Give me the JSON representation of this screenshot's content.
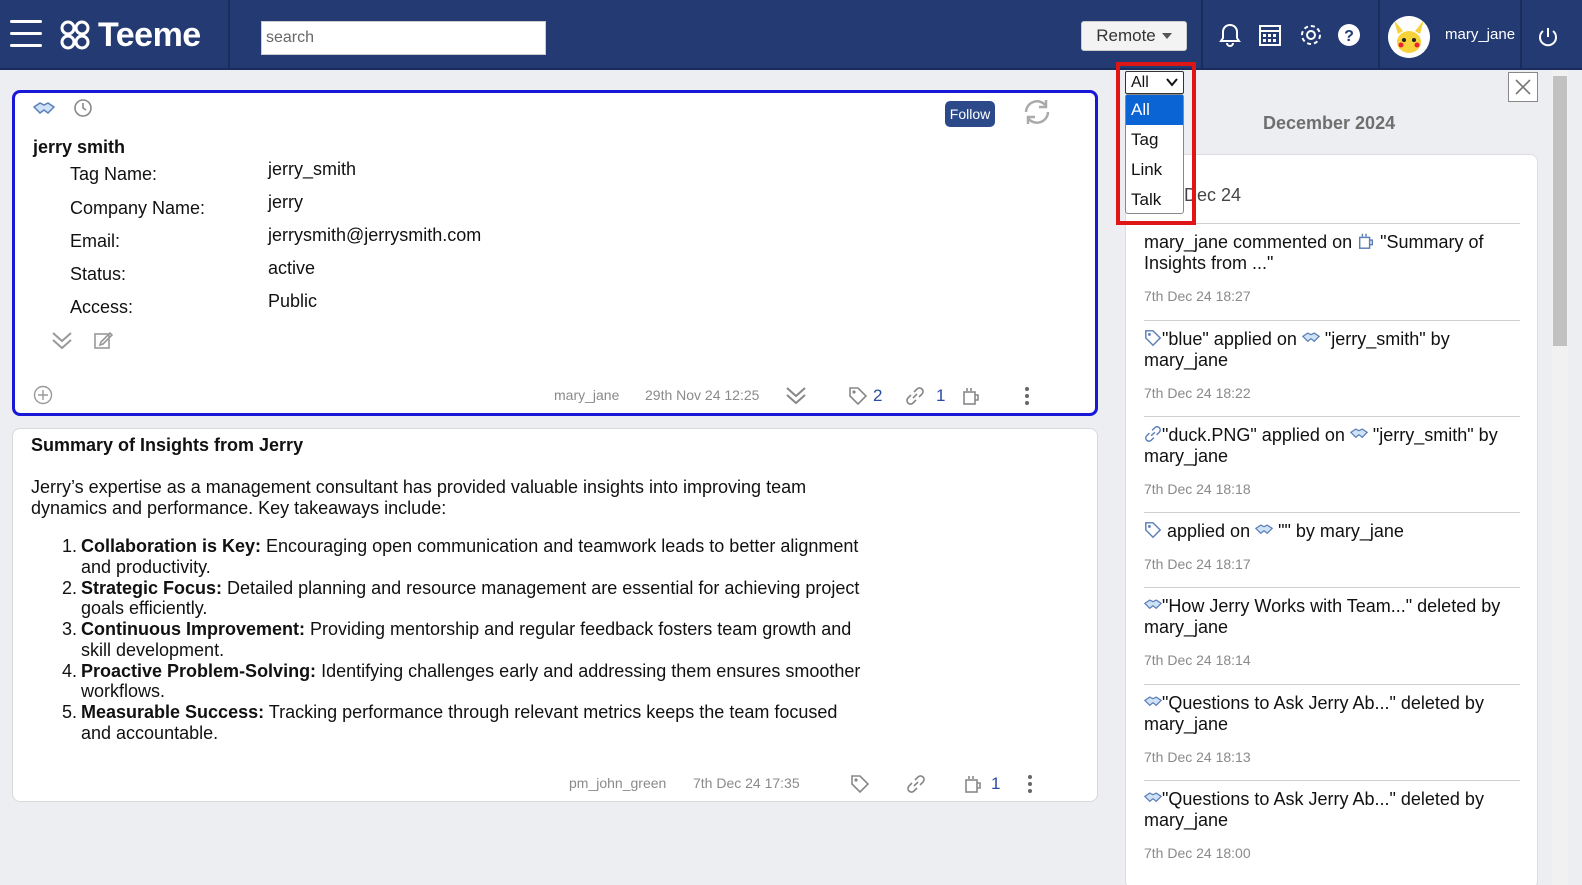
{
  "topbar": {
    "logo_text": "Teeme",
    "search_placeholder": "search",
    "remote_label": "Remote",
    "username": "mary_jane"
  },
  "card1": {
    "follow_label": "Follow",
    "title": "jerry smith",
    "fields": [
      {
        "label": "Tag Name:",
        "value": "jerry_smith"
      },
      {
        "label": "Company Name:",
        "value": "jerry"
      },
      {
        "label": "Email:",
        "value": "jerrysmith@jerrysmith.com"
      },
      {
        "label": "Status:",
        "value": "active"
      },
      {
        "label": "Access:",
        "value": "Public"
      }
    ],
    "author": "mary_jane",
    "timestamp": "29th Nov 24 12:25",
    "tag_count": "2",
    "link_count": "1"
  },
  "card2": {
    "title": "Summary of Insights from Jerry",
    "intro": "Jerry’s expertise as a management consultant has provided valuable insights into improving team dynamics and performance. Key takeaways include:",
    "items": [
      {
        "num": "1.",
        "bold": "Collaboration is Key:",
        "text": " Encouraging open communication and teamwork leads to better alignment and productivity."
      },
      {
        "num": "2.",
        "bold": "Strategic Focus:",
        "text": " Detailed planning and resource management are essential for achieving project goals efficiently."
      },
      {
        "num": "3.",
        "bold": "Continuous Improvement:",
        "text": " Providing mentorship and regular feedback fosters team growth and skill development."
      },
      {
        "num": "4.",
        "bold": "Proactive Problem-Solving:",
        "text": " Identifying challenges early and addressing them ensures smoother workflows."
      },
      {
        "num": "5.",
        "bold": "Measurable Success:",
        "text": " Tracking performance through relevant metrics keeps the team focused and accountable."
      }
    ],
    "author": "pm_john_green",
    "timestamp": "7th Dec 24 17:35",
    "talk_count": "1"
  },
  "panel": {
    "month": "December 2024",
    "date_head": "Dec 24",
    "filter": {
      "selected": "All",
      "options": [
        "All",
        "Tag",
        "Link",
        "Talk"
      ]
    },
    "feed": [
      {
        "pre": "mary_jane commented on ",
        "icon": "talk-icon",
        "post": " \"Summary of Insights from ...\"",
        "time": "7th Dec 24 18:27"
      },
      {
        "pre_icon": "tag-icon",
        "pre": "\"blue\" applied on ",
        "icon": "handshake-icon",
        "post": " \"jerry_smith\" by mary_jane",
        "time": "7th Dec 24 18:22"
      },
      {
        "pre_icon": "link-icon",
        "pre": "\"duck.PNG\" applied on ",
        "icon": "handshake-icon",
        "post": " \"jerry_smith\" by mary_jane",
        "time": "7th Dec 24 18:18"
      },
      {
        "pre_icon": "tag-icon",
        "pre": " applied on ",
        "icon": "handshake-icon",
        "post": " \"\" by mary_jane",
        "time": "7th Dec 24 18:17"
      },
      {
        "pre_icon": "handshake-icon",
        "pre": "\"How Jerry Works with Team...\" deleted by mary_jane",
        "time": "7th Dec 24 18:14"
      },
      {
        "pre_icon": "handshake-icon",
        "pre": "\"Questions to Ask Jerry Ab...\" deleted by mary_jane",
        "time": "7th Dec 24 18:13"
      },
      {
        "pre_icon": "handshake-icon",
        "pre": "\"Questions to Ask Jerry Ab...\" deleted by mary_jane",
        "time": "7th Dec 24 18:00"
      }
    ]
  }
}
